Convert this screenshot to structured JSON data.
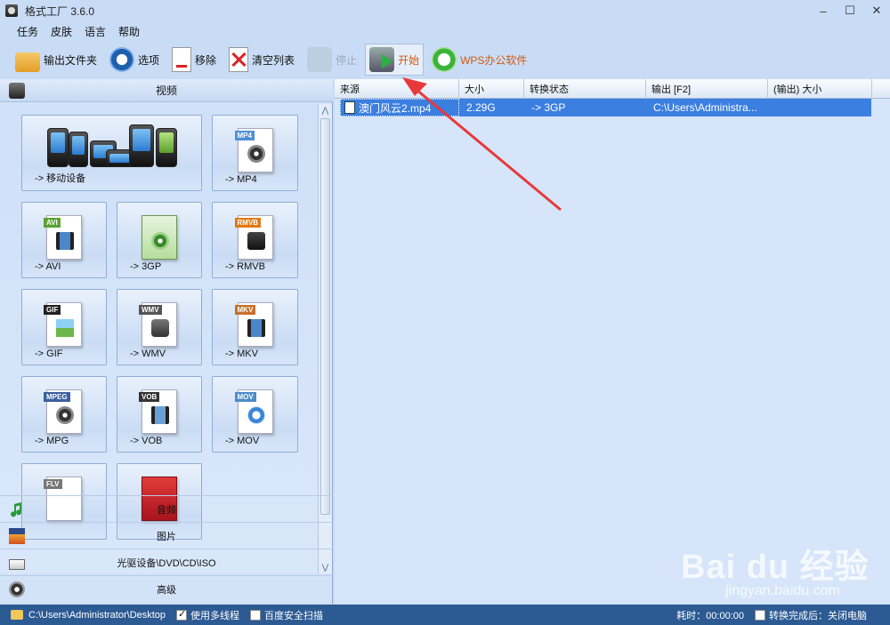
{
  "window": {
    "title": "格式工厂 3.6.0",
    "minimize": "–",
    "maximize": "☐",
    "close": "✕"
  },
  "menu": [
    "任务",
    "皮肤",
    "语言",
    "帮助"
  ],
  "toolbar": {
    "output_folder": "输出文件夹",
    "options": "选项",
    "remove": "移除",
    "clear_list": "清空列表",
    "stop": "停止",
    "start": "开始",
    "wps": "WPS办公软件"
  },
  "left": {
    "video_header": "视频",
    "tiles": [
      {
        "label": "-> 移动设备"
      },
      {
        "label": "-> MP4",
        "badge": "MP4",
        "color": "#4f8fd6"
      },
      {
        "label": "-> AVI",
        "badge": "AVI",
        "color": "#5aa232"
      },
      {
        "label": "-> 3GP",
        "badge": "",
        "color": "#3a9a40"
      },
      {
        "label": "-> RMVB",
        "badge": "RMVB",
        "color": "#e07a18"
      },
      {
        "label": "-> GIF",
        "badge": "GIF",
        "color": "#222222"
      },
      {
        "label": "-> WMV",
        "badge": "WMV",
        "color": "#555555"
      },
      {
        "label": "-> MKV",
        "badge": "MKV",
        "color": "#c7702b"
      },
      {
        "label": "-> MPG",
        "badge": "MPEG",
        "color": "#3b5f9e"
      },
      {
        "label": "-> VOB",
        "badge": "VOB",
        "color": "#333333"
      },
      {
        "label": "-> MOV",
        "badge": "MOV",
        "color": "#4d8cc9"
      },
      {
        "label": "",
        "badge": "FLV",
        "color": "#777777"
      },
      {
        "label": "",
        "badge": "",
        "color": "#c8202a"
      }
    ],
    "categories": {
      "audio": "音频",
      "image": "图片",
      "rom": "光驱设备\\DVD\\CD\\ISO",
      "advanced": "高级"
    },
    "scroll_up": "⋀",
    "scroll_down": "⋁"
  },
  "list": {
    "columns": [
      "来源",
      "大小",
      "转换状态",
      "输出 [F2]",
      "(输出) 大小"
    ],
    "rows": [
      {
        "source": "澳门风云2.mp4",
        "size": "2.29G",
        "status": "-> 3GP",
        "output": "C:\\Users\\Administra...",
        "out_size": ""
      }
    ]
  },
  "watermark": {
    "brand": "Bai du 经验",
    "url": "jingyan.baidu.com"
  },
  "status": {
    "path": "C:\\Users\\Administrator\\Desktop",
    "multithread": "使用多线程",
    "multithread_checked": true,
    "baidu_scan": "百度安全扫描",
    "baidu_scan_checked": false,
    "elapsed": "耗时：00:00:00",
    "after_done": "转换完成后：关闭电脑",
    "after_done_checked": false
  }
}
